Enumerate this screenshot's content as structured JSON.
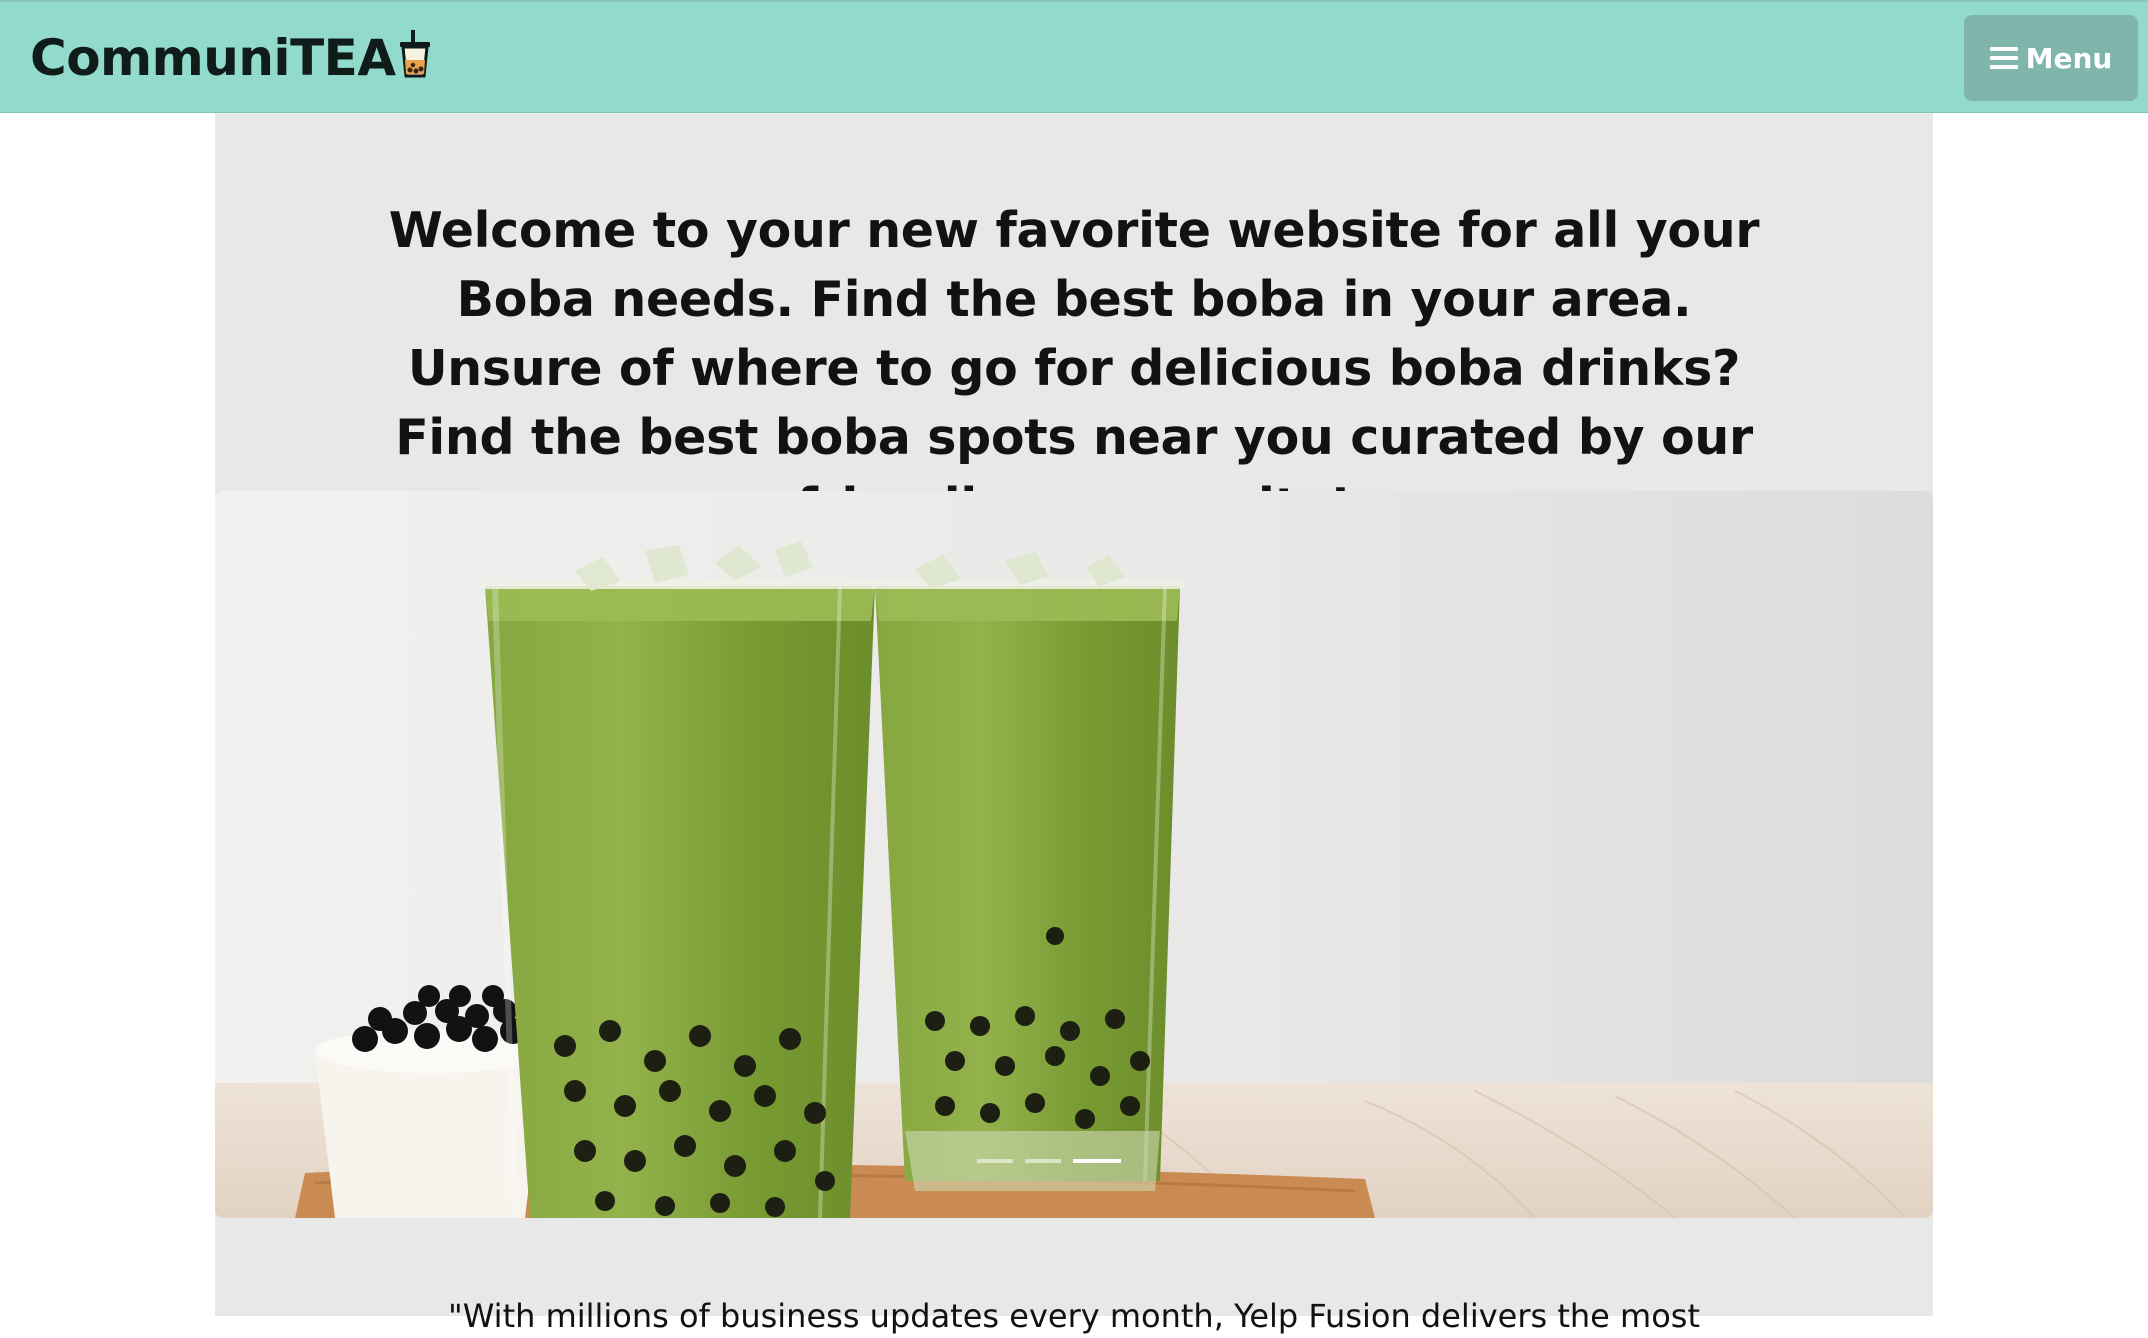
{
  "navbar": {
    "brand": "CommuniTEA",
    "brand_icon": "boba-cup-icon",
    "menu_label": "Menu",
    "menu_icon": "hamburger-icon",
    "background_color": "#92dbcc",
    "menu_button_color": "#80b5ab"
  },
  "intro": {
    "text": "Welcome to your new favorite website for all your Boba needs. Find the best boba in your area. Unsure of where to go for delicious boba drinks? Find the best boba spots near you curated by our friendly community!"
  },
  "carousel": {
    "image": "matcha-bubble-tea-photo",
    "slide_count": 3,
    "active_slide": 3
  },
  "quote": {
    "text": "\"With millions of business updates every month, Yelp Fusion delivers the most"
  },
  "colors": {
    "content_background": "#e8e8e8",
    "text": "#121212"
  }
}
